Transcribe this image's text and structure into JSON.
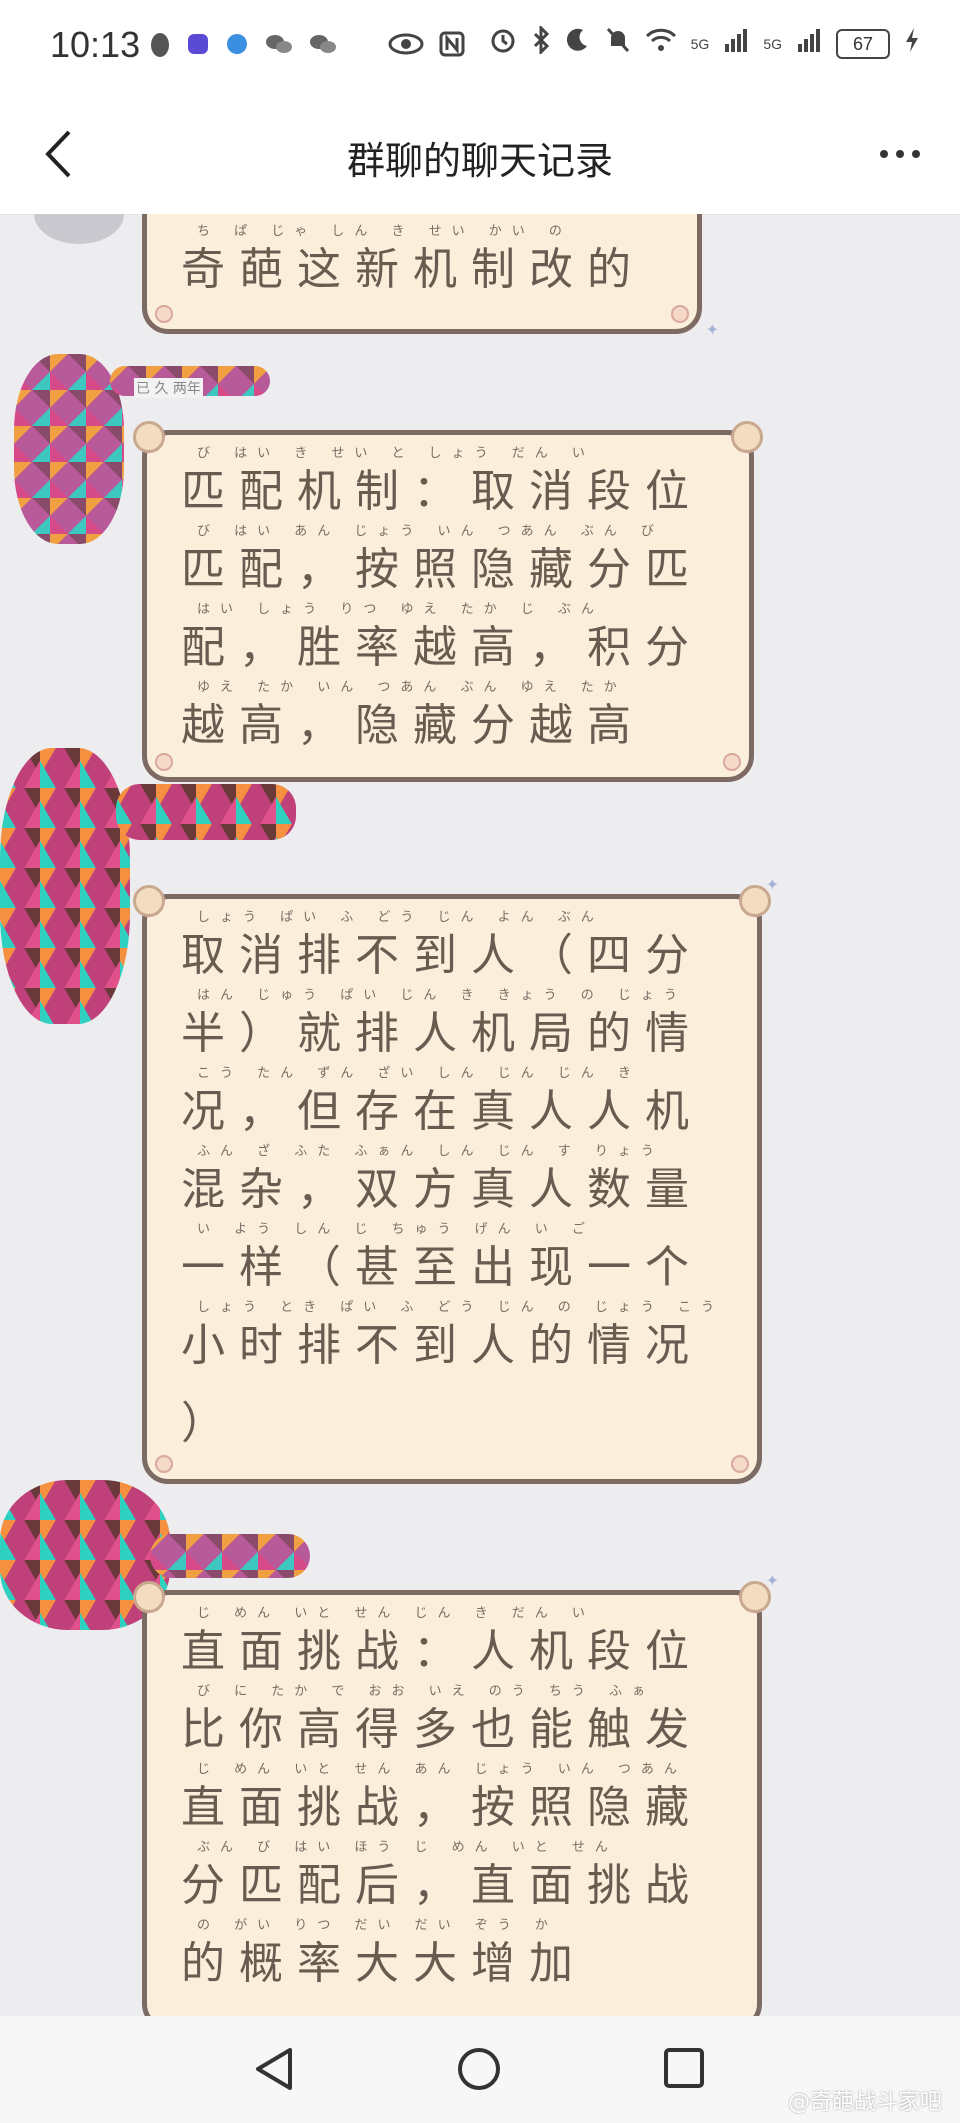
{
  "status_bar": {
    "time": "10:13",
    "left_icons": [
      "penguin-icon",
      "tieba-icon",
      "browser-icon",
      "wechat-icon",
      "wechat-icon",
      "eye-icon",
      "nfc-icon"
    ],
    "signal_label_1": "5G",
    "signal_label_2": "5G",
    "battery": "67"
  },
  "header": {
    "title": "群聊的聊天记录"
  },
  "messages": [
    {
      "ruby": "ち ぱ じゃ しん き せい かい の",
      "lines": [
        "奇葩这新机制改的"
      ]
    },
    {
      "nickname": "已 久 两年",
      "ruby": [
        "び はい き せい と しょう だん い",
        "び はい あん じょう いん つあん ぶん び",
        "はい しょう りつ ゆえ たか じ ぶん",
        "ゆえ たか いん つあん ぶん ゆえ たか"
      ],
      "lines": [
        "匹配机制：取消段位",
        "匹配，按照隐藏分匹",
        "配，胜率越高，积分",
        "越高，隐藏分越高"
      ]
    },
    {
      "ruby": [
        "しょう ぱい ふ どう じん よん ぶん",
        "はん じゅう ぱい じん き きょう の じょう",
        "こう たん ずん ざい しん じん じん き",
        "ふん ざ ふた ふぁん しん じん す りょう",
        "い よう しん じ ちゅう げん い ご",
        "しょう とき ぱい ふ どう じん の じょう こう",
        ""
      ],
      "lines": [
        "取消排不到人（四分",
        "半）就排人机局的情",
        "况，但存在真人人机",
        "混杂，双方真人数量",
        "一样（甚至出现一个",
        "小时排不到人的情况",
        "）"
      ]
    },
    {
      "ruby": [
        "じ めん いと せん じん き だん い",
        "び に たか で おお いえ のう ちう ふぁ",
        "じ めん いと せん あん じょう いん つあん",
        "ぶん び はい ほう じ めん いと せん",
        "の がい りつ だい だい ぞう か"
      ],
      "lines": [
        "直面挑战：人机段位",
        "比你高得多也能触发",
        "直面挑战，按照隐藏",
        "分匹配后，直面挑战",
        "的概率大大增加"
      ]
    }
  ],
  "nav": {
    "back": "back-triangle-icon",
    "home": "home-circle-icon",
    "recent": "recent-square-icon"
  },
  "watermark": "@奇葩战斗家吧"
}
